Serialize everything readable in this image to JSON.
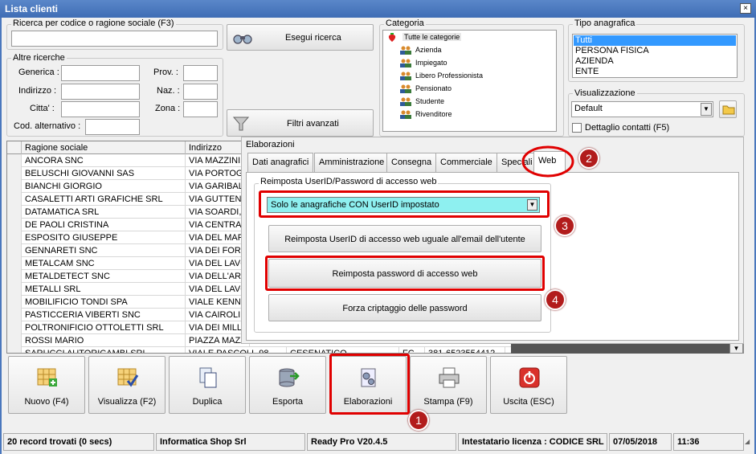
{
  "window": {
    "title": "Lista clienti",
    "close_glyph": "×"
  },
  "search": {
    "label": "Ricerca per codice o ragione sociale (F3)",
    "value": "",
    "execute_label": "Esegui ricerca"
  },
  "other": {
    "legend": "Altre ricerche",
    "generica": "Generica :",
    "indirizzo": "Indirizzo :",
    "citta": "Citta' :",
    "cod_alt": "Cod. alternativo :",
    "prov": "Prov. :",
    "naz": "Naz. :",
    "zona": "Zona :",
    "filters_label": "Filtri avanzati"
  },
  "category": {
    "legend": "Categoria",
    "root": "Tutte le categorie",
    "items": [
      "Azienda",
      "Impiegato",
      "Libero Professionista",
      "Pensionato",
      "Studente",
      "Rivenditore"
    ]
  },
  "tipo": {
    "legend": "Tipo anagrafica",
    "items": [
      "Tutti",
      "PERSONA FISICA",
      "AZIENDA",
      "ENTE"
    ],
    "selected": "Tutti"
  },
  "visual": {
    "legend": "Visualizzazione",
    "value": "Default",
    "detail_label": "Dettaglio contatti (F5)",
    "detail_checked": false
  },
  "grid": {
    "headers": [
      "Ragione sociale",
      "Indirizzo"
    ],
    "rows": [
      {
        "name": "ANCORA SNC",
        "addr": "VIA MAZZINI,"
      },
      {
        "name": "BELUSCHI GIOVANNI SAS",
        "addr": "VIA PORTOGA"
      },
      {
        "name": "BIANCHI GIORGIO",
        "addr": "VIA GARIBALD"
      },
      {
        "name": "CASALETTI ARTI GRAFICHE SRL",
        "addr": "VIA GUTTENBE"
      },
      {
        "name": "DATAMATICA SRL",
        "addr": "VIA SOARDI,"
      },
      {
        "name": "DE PAOLI CRISTINA",
        "addr": "VIA CENTRALE"
      },
      {
        "name": "ESPOSITO GIUSEPPE",
        "addr": "VIA DEL MARE"
      },
      {
        "name": "GENNARETI SNC",
        "addr": "VIA DEI FORZ"
      },
      {
        "name": "METALCAM SNC",
        "addr": "VIA DEL LAVO"
      },
      {
        "name": "METALDETECT SNC",
        "addr": "VIA DELL'ARTI"
      },
      {
        "name": "METALLI SRL",
        "addr": "VIA DEL LAVO"
      },
      {
        "name": "MOBILIFICIO TONDI SPA",
        "addr": "VIALE KENNED"
      },
      {
        "name": "PASTICCERIA VIBERTI SNC",
        "addr": "VIA CAIROLI,"
      },
      {
        "name": "POLTRONIFICIO OTTOLETTI SRL",
        "addr": "VIA DEI MILLE"
      },
      {
        "name": "ROSSI MARIO",
        "addr": "PIAZZA MAZZ"
      }
    ],
    "last_row": {
      "name": "SARUCCI AUTORICAMBI SRL",
      "addr": "VIALE PASCOLI, 98",
      "city": "CESENATICO",
      "prov": "FC",
      "phone": "381-6523554412"
    }
  },
  "elab": {
    "legend": "Elaborazioni",
    "tabs": [
      "Dati anagrafici",
      "Amministrazione",
      "Consegna",
      "Commerciale",
      "Speciali",
      "Web"
    ],
    "active_tab": "Web",
    "reset_legend": "Reimposta UserID/Password di accesso web",
    "select_value": "Solo le anagrafiche CON UserID impostato",
    "btn_userid": "Reimposta UserID di accesso web uguale all'email dell'utente",
    "btn_password": "Reimposta password di accesso web",
    "btn_crypt": "Forza criptaggio delle password"
  },
  "toolbar": [
    "Nuovo (F4)",
    "Visualizza (F2)",
    "Duplica",
    "Esporta",
    "Elaborazioni",
    "Stampa (F9)",
    "Uscita (ESC)"
  ],
  "status": {
    "records": "20 record trovati (0 secs)",
    "company": "Informatica Shop Srl",
    "version": "Ready Pro V20.4.5",
    "license": "Intestatario licenza : CODICE SRL",
    "date": "07/05/2018",
    "time": "11:36"
  },
  "annotations": [
    "1",
    "2",
    "3",
    "4"
  ],
  "colors": {
    "annotation_red": "#e00000",
    "badge_red": "#b21c1c",
    "select_bg": "#8ef0f0",
    "list_selected": "#3399ff"
  }
}
